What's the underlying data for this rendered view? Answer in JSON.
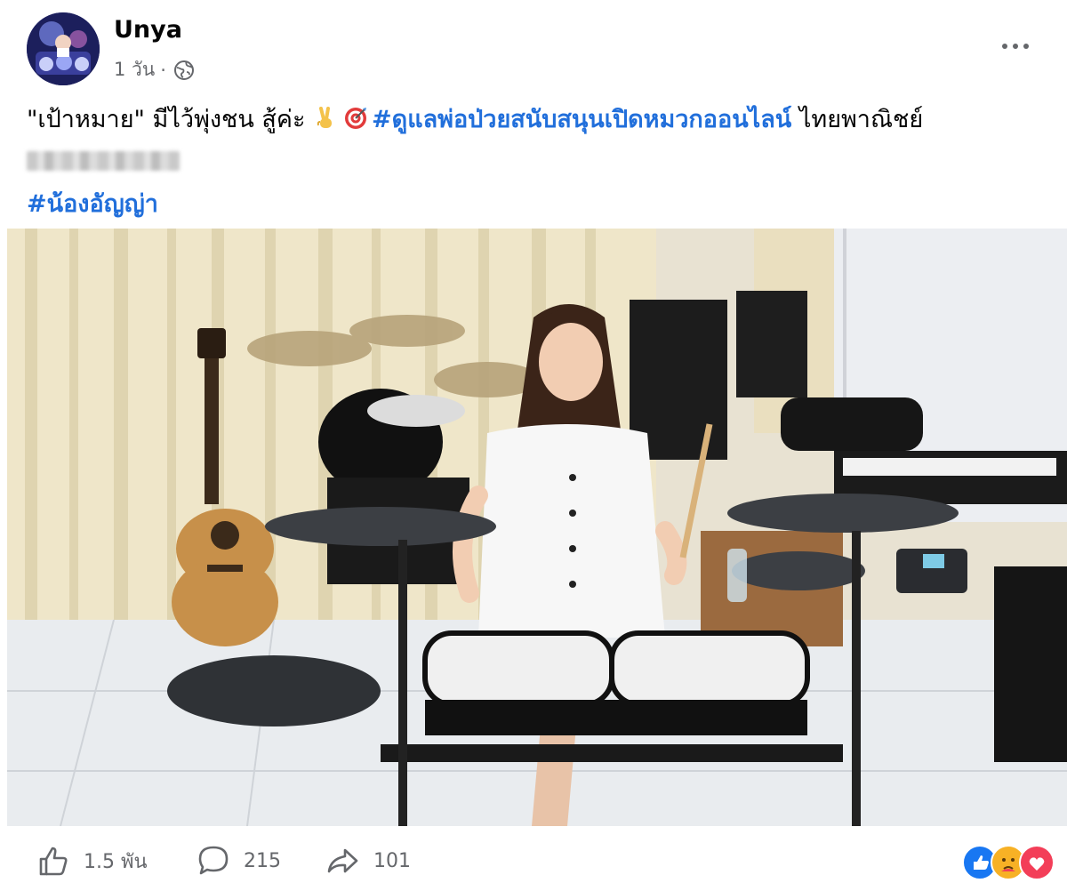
{
  "post": {
    "author": "Unya",
    "time": "1 วัน",
    "separator": "·",
    "text": {
      "part1": "\"เป้าหมาย\" มีไว้พุ่งชน สู้ค่ะ",
      "hashtag1": "#ดูแลพ่อป่วยสนับสนุนเปิดหมวกออนไลน์",
      "part2": " ไทยพาณิชย์",
      "hashtag2": "#น้องอัญญ่า"
    }
  },
  "footer": {
    "likes": "1.5 พัน",
    "comments": "215",
    "shares": "101"
  },
  "icons": {
    "globe": "globe-icon",
    "more": "more-options-icon",
    "like": "thumbs-up-icon",
    "comment": "comment-icon",
    "share": "share-icon",
    "reaction_like": "like-reaction-icon",
    "reaction_care": "care-reaction-icon",
    "reaction_love": "love-reaction-icon"
  },
  "colors": {
    "hashtag": "#216fdb",
    "secondary_text": "#65676b",
    "like_blue": "#1877f2",
    "love_red": "#f33e58",
    "care_yellow": "#f7b125"
  }
}
